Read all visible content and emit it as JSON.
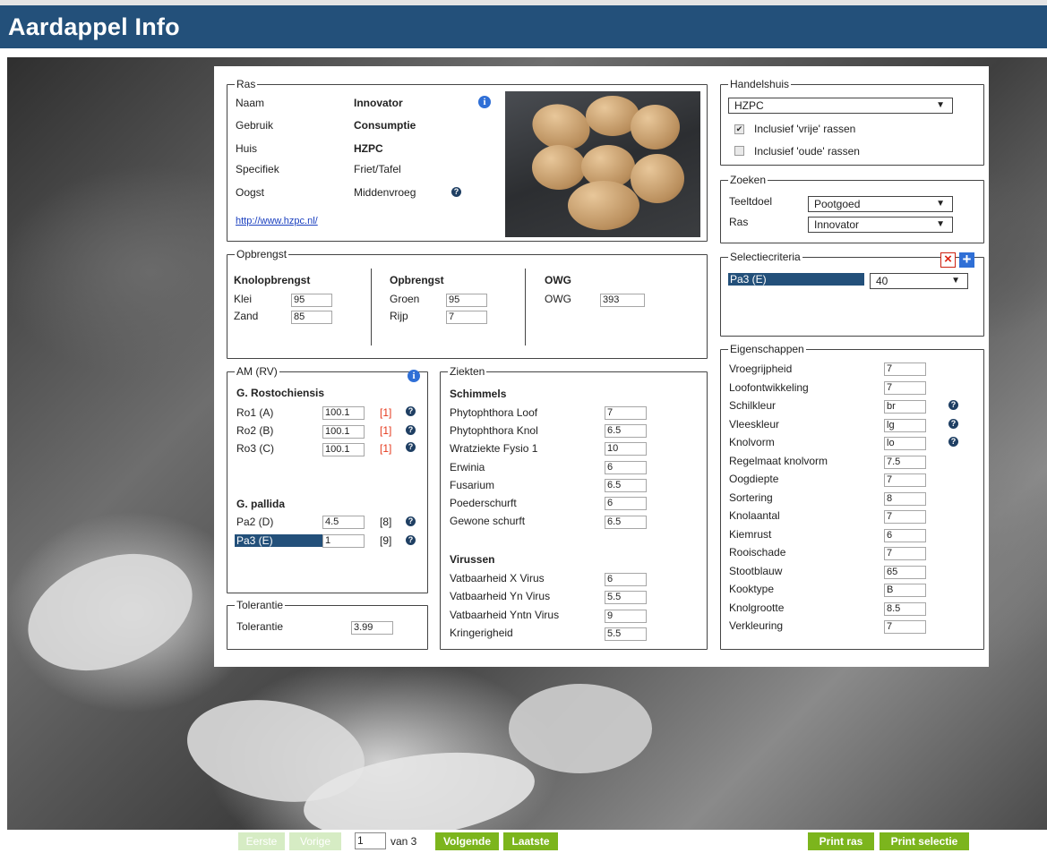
{
  "app_title": "Aardappel Info",
  "ras": {
    "legend": "Ras",
    "rows": [
      {
        "label": "Naam",
        "value": "Innovator"
      },
      {
        "label": "Gebruik",
        "value": "Consumptie"
      },
      {
        "label": "Huis",
        "value": "HZPC"
      },
      {
        "label": "Specifiek",
        "value": "Friet/Tafel"
      },
      {
        "label": "Oogst",
        "value": "Middenvroeg"
      }
    ],
    "link": "http://www.hzpc.nl/"
  },
  "handelshuis": {
    "legend": "Handelshuis",
    "selected": "HZPC",
    "check_vrije": {
      "label": "Inclusief 'vrije' rassen",
      "checked": true
    },
    "check_oude": {
      "label": "Inclusief 'oude' rassen",
      "checked": false
    }
  },
  "zoeken": {
    "legend": "Zoeken",
    "teeltdoel_label": "Teeltdoel",
    "teeltdoel_value": "Pootgoed",
    "ras_label": "Ras",
    "ras_value": "Innovator"
  },
  "selectiecriteria": {
    "legend": "Selectiecriteria",
    "criterion": "Pa3 (E)",
    "value": "40"
  },
  "opbrengst": {
    "legend": "Opbrengst",
    "knol": {
      "title": "Knolopbrengst",
      "rows": [
        {
          "label": "Klei",
          "value": "95"
        },
        {
          "label": "Zand",
          "value": "85"
        }
      ]
    },
    "opb": {
      "title": "Opbrengst",
      "rows": [
        {
          "label": "Groen",
          "value": "95"
        },
        {
          "label": "Rijp",
          "value": "7"
        }
      ]
    },
    "owg": {
      "title": "OWG",
      "rows": [
        {
          "label": "OWG",
          "value": "393"
        }
      ]
    }
  },
  "am": {
    "legend": "AM (RV)",
    "g_rosto": "G. Rostochiensis",
    "rosto_rows": [
      {
        "label": "Ro1 (A)",
        "value": "100.1",
        "ref": "[1]"
      },
      {
        "label": "Ro2 (B)",
        "value": "100.1",
        "ref": "[1]"
      },
      {
        "label": "Ro3 (C)",
        "value": "100.1",
        "ref": "[1]"
      }
    ],
    "g_pallida": "G. pallida",
    "pallida_rows": [
      {
        "label": "Pa2 (D)",
        "value": "4.5",
        "ref": "[8]"
      },
      {
        "label": "Pa3 (E)",
        "value": "1",
        "ref": "[9]"
      }
    ]
  },
  "tolerantie": {
    "legend": "Tolerantie",
    "label": "Tolerantie",
    "value": "3.99"
  },
  "ziekten": {
    "legend": "Ziekten",
    "schimmels_title": "Schimmels",
    "schimmels": [
      {
        "label": "Phytophthora Loof",
        "value": "7"
      },
      {
        "label": "Phytophthora Knol",
        "value": "6.5"
      },
      {
        "label": "Wratziekte Fysio 1",
        "value": "10"
      },
      {
        "label": "Erwinia",
        "value": "6"
      },
      {
        "label": "Fusarium",
        "value": "6.5"
      },
      {
        "label": "Poederschurft",
        "value": "6"
      },
      {
        "label": "Gewone schurft",
        "value": "6.5"
      }
    ],
    "virussen_title": "Virussen",
    "virussen": [
      {
        "label": "Vatbaarheid X Virus",
        "value": "6"
      },
      {
        "label": "Vatbaarheid Yn Virus",
        "value": "5.5"
      },
      {
        "label": "Vatbaarheid Yntn Virus",
        "value": "9"
      },
      {
        "label": "Kringerigheid",
        "value": "5.5"
      }
    ]
  },
  "eigenschappen": {
    "legend": "Eigenschappen",
    "rows": [
      {
        "label": "Vroegrijpheid",
        "value": "7"
      },
      {
        "label": "Loofontwikkeling",
        "value": "7"
      },
      {
        "label": "Schilkleur",
        "value": "br"
      },
      {
        "label": "Vleeskleur",
        "value": "lg"
      },
      {
        "label": "Knolvorm",
        "value": "lo"
      },
      {
        "label": "Regelmaat knolvorm",
        "value": "7.5"
      },
      {
        "label": "Oogdiepte",
        "value": "7"
      },
      {
        "label": "Sortering",
        "value": "8"
      },
      {
        "label": "Knolaantal",
        "value": "7"
      },
      {
        "label": "Kiemrust",
        "value": "6"
      },
      {
        "label": "Rooischade",
        "value": "7"
      },
      {
        "label": "Stootblauw",
        "value": "65"
      },
      {
        "label": "Kooktype",
        "value": "B"
      },
      {
        "label": "Knolgrootte",
        "value": "8.5"
      },
      {
        "label": "Verkleuring",
        "value": "7"
      }
    ]
  },
  "pagination": {
    "eerste": "Eerste",
    "vorige": "Vorige",
    "page": "1",
    "van": "van 3",
    "volgende": "Volgende",
    "laatste": "Laatste",
    "print_ras": "Print ras",
    "print_selectie": "Print selectie"
  },
  "icons": {
    "info": "i",
    "question": "?",
    "remove": "×",
    "add": "+",
    "dropdown": "▼",
    "check": "✔"
  },
  "colors": {
    "header": "#23507a",
    "button_green": "#7cb51d",
    "highlight": "#23507a"
  }
}
